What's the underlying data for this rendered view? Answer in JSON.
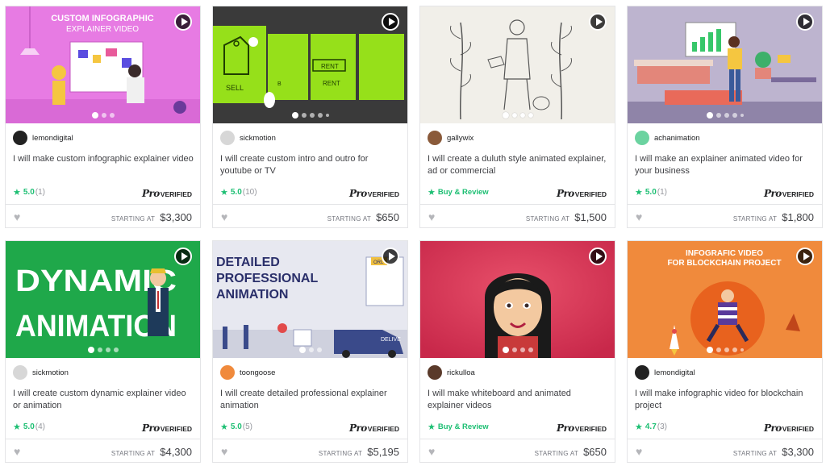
{
  "gigs": [
    {
      "seller": "lemondigital",
      "avatar_color": "#222222",
      "title": "I will make custom infographic explainer video",
      "rating": "5.0",
      "reviews": "(1)",
      "buy_review": "",
      "pro_label": "Pro",
      "verified_label": "VERIFIED",
      "starting_label": "STARTING AT",
      "price": "$3,300",
      "thumb_text": [
        "CUSTOM INFOGRAPHIC",
        "EXPLAINER VIDEO"
      ],
      "thumb_bg": "#e77be3"
    },
    {
      "seller": "sickmotion",
      "avatar_color": "#d7d7d7",
      "title": "I will create custom intro and outro for youtube or TV",
      "rating": "5.0",
      "reviews": "(10)",
      "buy_review": "",
      "pro_label": "Pro",
      "verified_label": "VERIFIED",
      "starting_label": "STARTING AT",
      "price": "$650",
      "thumb_text": [
        "SELL",
        "RENT",
        "RENT",
        "B"
      ],
      "thumb_bg": "#3a3a3a"
    },
    {
      "seller": "gallywix",
      "avatar_color": "#8a5a3a",
      "title": "I will create a duluth style animated explainer, ad or commercial",
      "rating": "",
      "reviews": "",
      "buy_review": "Buy & Review",
      "pro_label": "Pro",
      "verified_label": "VERIFIED",
      "starting_label": "STARTING AT",
      "price": "$1,500",
      "thumb_text": [],
      "thumb_bg": "#f1efe9"
    },
    {
      "seller": "achanimation",
      "avatar_color": "#6bd3a0",
      "title": "I will make an explainer animated video for your business",
      "rating": "5.0",
      "reviews": "(1)",
      "buy_review": "",
      "pro_label": "Pro",
      "verified_label": "VERIFIED",
      "starting_label": "STARTING AT",
      "price": "$1,800",
      "thumb_text": [],
      "thumb_bg": "#bdb4cf"
    },
    {
      "seller": "sickmotion",
      "avatar_color": "#d7d7d7",
      "title": "I will create custom dynamic explainer video or animation",
      "rating": "5.0",
      "reviews": "(4)",
      "buy_review": "",
      "pro_label": "Pro",
      "verified_label": "VERIFIED",
      "starting_label": "STARTING AT",
      "price": "$4,300",
      "thumb_text": [
        "DYNAMIC",
        "ANIMATION"
      ],
      "thumb_bg": "#1fa84a"
    },
    {
      "seller": "toongoose",
      "avatar_color": "#f08a3c",
      "title": "I will create detailed professional explainer animation",
      "rating": "5.0",
      "reviews": "(5)",
      "buy_review": "",
      "pro_label": "Pro",
      "verified_label": "VERIFIED",
      "starting_label": "STARTING AT",
      "price": "$5,195",
      "thumb_text": [
        "DETAILED",
        "PROFESSIONAL",
        "ANIMATION",
        "ORL",
        "DELIVE"
      ],
      "thumb_bg": "#e7e8f0"
    },
    {
      "seller": "rickulloa",
      "avatar_color": "#5a3a2a",
      "title": "I will make whiteboard and animated explainer videos",
      "rating": "",
      "reviews": "",
      "buy_review": "Buy & Review",
      "pro_label": "Pro",
      "verified_label": "VERIFIED",
      "starting_label": "STARTING AT",
      "price": "$650",
      "thumb_text": [],
      "thumb_bg": "#d93a5a"
    },
    {
      "seller": "lemondigital",
      "avatar_color": "#222222",
      "title": "I will make infographic video for blockchain project",
      "rating": "4.7",
      "reviews": "(3)",
      "buy_review": "",
      "pro_label": "Pro",
      "verified_label": "VERIFIED",
      "starting_label": "STARTING AT",
      "price": "$3,300",
      "thumb_text": [
        "INFOGRAFIC VIDEO",
        "FOR BLOCKCHAIN PROJECT"
      ],
      "thumb_bg": "#f08a3c"
    }
  ],
  "icons": {
    "star": "star-icon",
    "heart": "heart-icon",
    "play": "play-icon"
  },
  "colors": {
    "accent": "#1dbf73",
    "border": "#e4e5e7"
  }
}
